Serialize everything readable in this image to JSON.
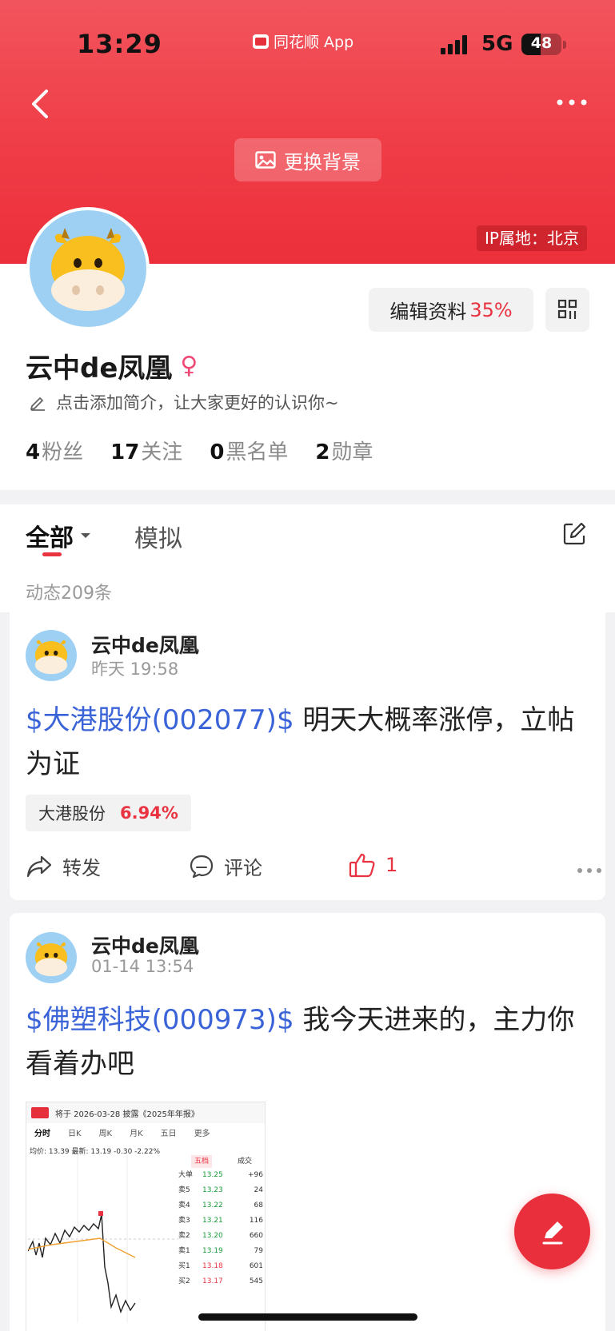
{
  "status_bar": {
    "time": "13:29",
    "app_name": "同花顺 App",
    "network": "5G",
    "battery": "48"
  },
  "header": {
    "change_bg_label": "更换背景",
    "ip_location": "IP属地：北京"
  },
  "profile": {
    "edit_label": "编辑资料",
    "edit_percent": "35%",
    "username": "云中de凤凰",
    "gender_symbol": "♀",
    "bio_placeholder": "点击添加简介，让大家更好的认识你~",
    "stats": [
      {
        "count": "4",
        "label": "粉丝"
      },
      {
        "count": "17",
        "label": "关注"
      },
      {
        "count": "0",
        "label": "黑名单"
      },
      {
        "count": "2",
        "label": "勋章"
      }
    ]
  },
  "feed": {
    "tabs": [
      "全部",
      "模拟"
    ],
    "count_text": "动态209条"
  },
  "posts": [
    {
      "author": "云中de凤凰",
      "time": "昨天 19:58",
      "stock_tag": "$大港股份(002077)$",
      "text": " 明天大概率涨停，立帖为证",
      "chip_name": "大港股份",
      "chip_change": "6.94%",
      "actions": {
        "repost": "转发",
        "comment": "评论",
        "likes": "1"
      }
    },
    {
      "author": "云中de凤凰",
      "time": "01-14 13:54",
      "stock_tag": "$佛塑科技(000973)$",
      "text": " 我今天进来的，主力你看着办吧",
      "thumbnail": {
        "notice": "将于 2026-03-28 披露《2025年年报》",
        "tabs": [
          "分时",
          "日K",
          "周K",
          "月K",
          "五日",
          "更多"
        ],
        "price_line": "均价: 13.39  最新: 13.19  -0.30  -2.22%",
        "book_headers": [
          "五档",
          "成交"
        ],
        "book_rows": [
          {
            "label": "大单",
            "price": "13.25",
            "vol": "+96"
          },
          {
            "label": "卖5",
            "price": "13.23",
            "vol": "24"
          },
          {
            "label": "卖4",
            "price": "13.22",
            "vol": "68"
          },
          {
            "label": "卖3",
            "price": "13.21",
            "vol": "116"
          },
          {
            "label": "卖2",
            "price": "13.20",
            "vol": "660"
          },
          {
            "label": "卖1",
            "price": "13.19",
            "vol": "79"
          },
          {
            "label": "买1",
            "price": "13.18",
            "vol": "601"
          },
          {
            "label": "买2",
            "price": "13.17",
            "vol": "545"
          }
        ]
      }
    }
  ],
  "colors": {
    "brand_red": "#ea2f3c",
    "link_blue": "#3a63d8",
    "avatar_bg": "#9ed0f3"
  }
}
